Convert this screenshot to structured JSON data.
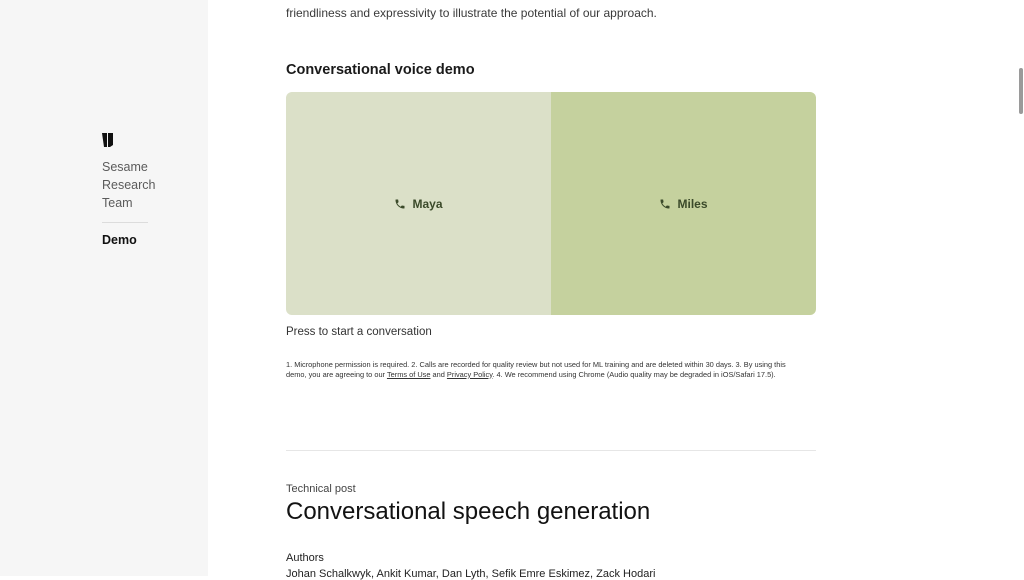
{
  "sidebar": {
    "items": [
      "Sesame",
      "Research",
      "Team"
    ],
    "active": "Demo"
  },
  "intro_text": "friendliness and expressivity to illustrate the potential of our approach.",
  "demo": {
    "heading": "Conversational voice demo",
    "voices": [
      "Maya",
      "Miles"
    ],
    "colors": {
      "left": "#dbe0c8",
      "right": "#c5d19e"
    },
    "prompt": "Press to start a conversation",
    "disclaimer": {
      "pre": "1. Microphone permission is required. 2. Calls are recorded for quality review but not used for ML training and are deleted within 30 days. 3. By using this demo, you are agreeing to our ",
      "terms": "Terms of Use",
      "and": " and ",
      "privacy": "Privacy Policy",
      "post": ". 4. We recommend using Chrome (Audio quality may be degraded in iOS/Safari 17.5)."
    }
  },
  "post": {
    "kicker": "Technical post",
    "title": "Conversational speech generation",
    "authors_heading": "Authors",
    "authors": "Johan Schalkwyk, Ankit Kumar, Dan Lyth, Sefik Emre Eskimez, Zack Hodari"
  },
  "icons": {
    "call": "phone-icon",
    "logo": "sesame-logo-icon"
  }
}
